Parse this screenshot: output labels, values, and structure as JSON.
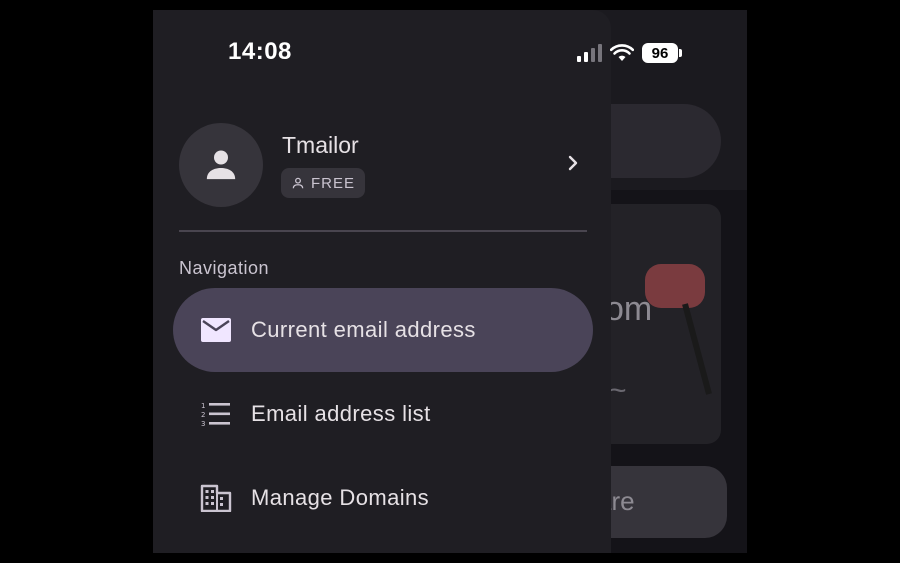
{
  "status_bar": {
    "time": "14:08",
    "battery": "96"
  },
  "profile": {
    "name": "Tmailor",
    "plan": "FREE"
  },
  "navigation": {
    "title": "Navigation",
    "items": [
      {
        "label": "Current email address",
        "icon": "mail-icon",
        "active": true
      },
      {
        "label": "Email address list",
        "icon": "numbered-list-icon",
        "active": false
      },
      {
        "label": "Manage Domains",
        "icon": "domain-icon",
        "active": false
      }
    ]
  },
  "background": {
    "card_text": "om",
    "button_text": "are"
  },
  "colors": {
    "drawer_bg": "#1f1e23",
    "active_item_bg": "#4a4458",
    "text_primary": "#e6e1e5",
    "text_secondary": "#cac4d0"
  }
}
